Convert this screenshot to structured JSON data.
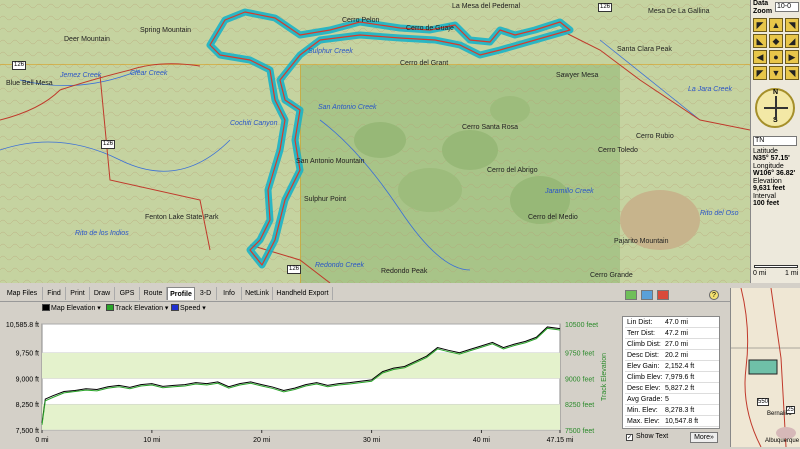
{
  "map": {
    "labels": [
      {
        "t": "Deer Mountain",
        "k": "place"
      },
      {
        "t": "Spring Mountain",
        "k": "place"
      },
      {
        "t": "Cerro Pelon",
        "k": "place"
      },
      {
        "t": "Cerro de Guaje",
        "k": "place"
      },
      {
        "t": "La Mesa del Pedernal",
        "k": "place"
      },
      {
        "t": "Mesa De La Gallina",
        "k": "place"
      },
      {
        "t": "Santa Clara Peak",
        "k": "place"
      },
      {
        "t": "Cerro del Grant",
        "k": "place"
      },
      {
        "t": "Cerro Santa Rosa",
        "k": "place"
      },
      {
        "t": "San Antonio Mountain",
        "k": "place"
      },
      {
        "t": "Cerro del Abrigo",
        "k": "place"
      },
      {
        "t": "Cerro del Medio",
        "k": "place"
      },
      {
        "t": "Pajarito Mountain",
        "k": "place"
      },
      {
        "t": "Redondo Peak",
        "k": "place"
      },
      {
        "t": "Cerro Grande",
        "k": "place"
      },
      {
        "t": "Fenton Lake State Park",
        "k": "place"
      },
      {
        "t": "Sulphur Point",
        "k": "place"
      },
      {
        "t": "Cerro Toledo",
        "k": "place"
      },
      {
        "t": "Blue Bell Mesa",
        "k": "place"
      },
      {
        "t": "Cerro Rubio",
        "k": "place"
      },
      {
        "t": "Sawyer Mesa",
        "k": "place"
      },
      {
        "t": "Jemez Creek",
        "k": "creek"
      },
      {
        "t": "Clear Creek",
        "k": "creek"
      },
      {
        "t": "Sulphur Creek",
        "k": "creek"
      },
      {
        "t": "Redondo Creek",
        "k": "creek"
      },
      {
        "t": "San Antonio Creek",
        "k": "creek"
      },
      {
        "t": "Jaramillo Creek",
        "k": "creek"
      },
      {
        "t": "Rito de los Indios",
        "k": "creek"
      },
      {
        "t": "Cochiti Canyon",
        "k": "creek"
      },
      {
        "t": "La Jara Creek",
        "k": "creek"
      },
      {
        "t": "Rito del Oso",
        "k": "creek"
      }
    ],
    "road_signs": [
      "126",
      "126",
      "126",
      "126"
    ]
  },
  "right_panel": {
    "data_label": "Data",
    "zoom_label": "Zoom",
    "zoom_value": "10-0",
    "lat_label": "Latitude",
    "lat": "N35° 57.15'",
    "lon_label": "Longitude",
    "lon": "W106° 36.82'",
    "elev_label": "Elevation",
    "elev": "9,631 feet",
    "interval_label": "Interval",
    "interval": "100 feet",
    "scale_left": "0 mi",
    "scale_right": "1 mi",
    "compass_n": "N",
    "compass_s": "S",
    "dropdown": "TN"
  },
  "tabs": [
    "Map Files",
    "Find",
    "Print",
    "Draw",
    "GPS",
    "Route",
    "Profile",
    "3-D",
    "Info",
    "NetLink",
    "Handheld Export"
  ],
  "active_tab": "Profile",
  "legend": {
    "map_elev": "Map Elevation",
    "track_elev": "Track Elevation",
    "speed": "Speed",
    "colors": {
      "map": "#000000",
      "track": "#2aa52a",
      "speed": "#2030d0"
    }
  },
  "chart_data": {
    "type": "line",
    "xlabel": "",
    "ylabel": "Track Elevation",
    "x_ticks": [
      "0 mi",
      "10 mi",
      "20 mi",
      "30 mi",
      "40 mi",
      "47.15 mi"
    ],
    "y_ticks_left": [
      "10,585.8 ft",
      "9,750 ft",
      "9,000 ft",
      "8,250 ft",
      "7,500 ft"
    ],
    "y_ticks_right": [
      "10500 feet",
      "9750 feet",
      "9000 feet",
      "8250 feet",
      "7500 feet"
    ],
    "xlim": [
      0,
      47.15
    ],
    "ylim": [
      7500,
      10586
    ],
    "x": [
      0,
      0.3,
      1,
      2,
      3,
      4,
      5,
      6,
      7,
      8,
      9,
      10,
      11,
      12,
      13,
      14,
      15,
      16,
      17,
      18,
      19,
      20,
      21,
      22,
      23,
      24,
      25,
      26,
      27,
      28,
      29,
      30,
      31,
      32,
      33,
      34,
      35,
      36,
      37,
      38,
      39,
      40,
      41,
      42,
      43,
      44,
      45,
      46,
      47.15
    ],
    "series": [
      {
        "name": "Map Elevation",
        "values": [
          7700,
          8400,
          8500,
          8620,
          8650,
          8700,
          8680,
          8760,
          8800,
          8740,
          8820,
          8850,
          8770,
          8800,
          8820,
          8880,
          8850,
          8900,
          8760,
          8850,
          8900,
          8820,
          8750,
          8650,
          8720,
          8820,
          8880,
          8800,
          8850,
          8880,
          8920,
          8960,
          9200,
          9300,
          9350,
          9500,
          9650,
          9900,
          9820,
          9750,
          9850,
          9950,
          10050,
          9900,
          10000,
          10080,
          10200,
          10500,
          10450
        ]
      },
      {
        "name": "Track Elevation",
        "values": [
          7650,
          8350,
          8450,
          8580,
          8620,
          8660,
          8640,
          8720,
          8760,
          8700,
          8780,
          8810,
          8730,
          8760,
          8780,
          8840,
          8810,
          8860,
          8720,
          8810,
          8860,
          8780,
          8710,
          8610,
          8680,
          8780,
          8840,
          8760,
          8810,
          8840,
          8880,
          8920,
          9160,
          9260,
          9310,
          9460,
          9610,
          9860,
          9780,
          9710,
          9810,
          9910,
          10010,
          9860,
          9960,
          10040,
          10160,
          10460,
          10410
        ]
      }
    ]
  },
  "stats": [
    {
      "k": "Lin Dist:",
      "v": "47.0 mi"
    },
    {
      "k": "Terr Dist:",
      "v": "47.2 mi"
    },
    {
      "k": "Climb Dist:",
      "v": "27.0 mi"
    },
    {
      "k": "Desc Dist:",
      "v": "20.2 mi"
    },
    {
      "k": "Elev Gain:",
      "v": "2,152.4 ft"
    },
    {
      "k": "Climb Elev:",
      "v": "7,979.6 ft"
    },
    {
      "k": "Desc Elev:",
      "v": "5,827.2 ft"
    },
    {
      "k": "Avg Grade:",
      "v": "5"
    },
    {
      "k": "Min. Elev:",
      "v": "8,278.3 ft"
    },
    {
      "k": "Max. Elev:",
      "v": "10,547.8 ft"
    }
  ],
  "show_text_label": "Show Text",
  "more_label": "More»",
  "minimap": {
    "labels": [
      "Bernalillo",
      "Albuquerque",
      "550",
      "25"
    ]
  }
}
